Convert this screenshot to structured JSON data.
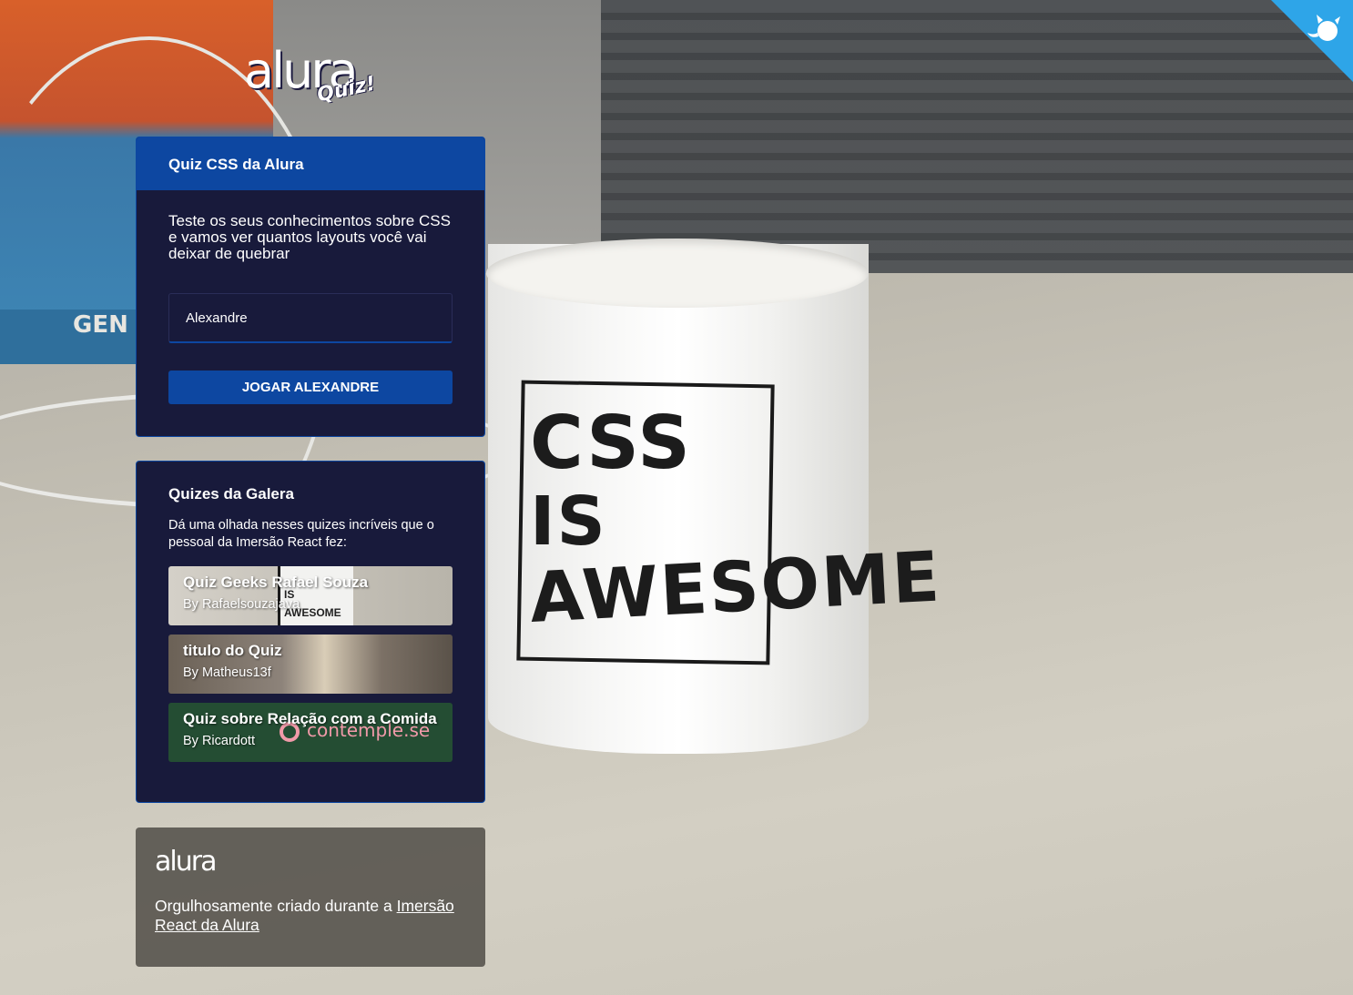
{
  "brand": {
    "logo_word": "alura",
    "logo_sub": "Quiz!",
    "primary_color": "#0d47a1",
    "panel_color": "#181a3b"
  },
  "main_card": {
    "title": "Quiz CSS da Alura",
    "description": "Teste os seus conhecimentos sobre CSS e vamos ver quantos layouts você vai deixar de quebrar",
    "name_input_value": "Alexandre",
    "play_button_label": "JOGAR ALEXANDRE"
  },
  "community": {
    "title": "Quizes da Galera",
    "description": "Dá uma olhada nesses quizes incríveis que o pessoal da Imersão React fez:",
    "items": [
      {
        "title": "Quiz Geeks Rafael Souza",
        "author": "By Rafaelsouzajava"
      },
      {
        "title": "titulo do Quiz",
        "author": "By Matheus13f"
      },
      {
        "title": "Quiz sobre Relação com a Comida",
        "author": "By Ricardott"
      }
    ],
    "watermark": "contemple.se"
  },
  "footer": {
    "logo_word": "alura",
    "text": "Orgulhosamente criado durante a ",
    "link_text": "Imersão React da Alura"
  },
  "background": {
    "mug_lines": [
      "CSS",
      "IS",
      "AWESOME"
    ],
    "box_text": "GEN"
  },
  "github_corner": {
    "icon": "github-octocat-icon",
    "color": "#2ea5e8"
  }
}
